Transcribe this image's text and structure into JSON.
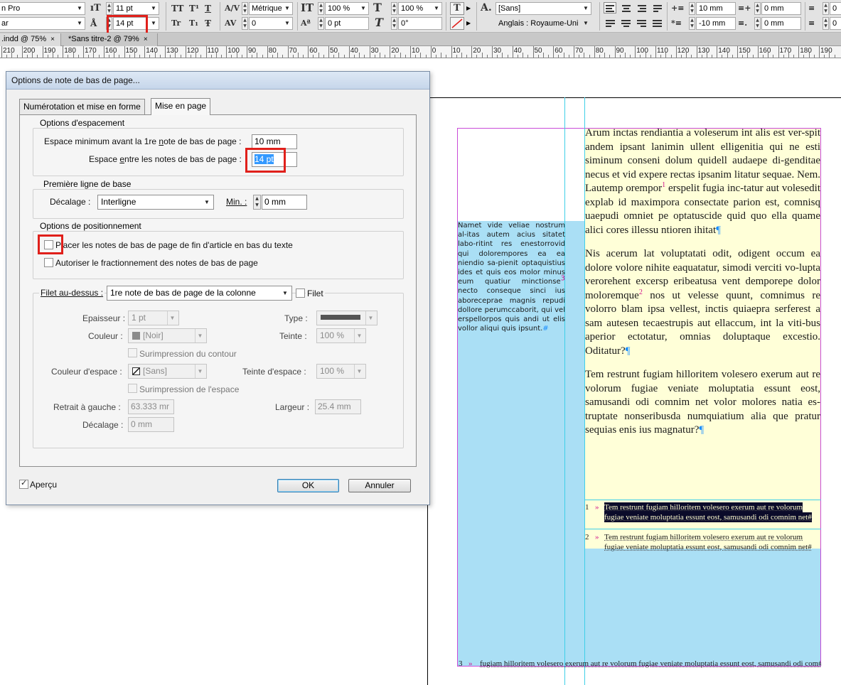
{
  "control_bar": {
    "font_family": "n Pro",
    "font_style": "ar",
    "font_size": "11 pt",
    "leading": "14 pt",
    "kerning": "Métrique",
    "tracking": "0",
    "vertical_scale": "100 %",
    "baseline_shift": "0 pt",
    "horizontal_scale": "100 %",
    "skew": "0°",
    "char_style": "[Sans]",
    "language": "Anglais : Royaume-Uni",
    "left_indent": "10 mm",
    "first_line_indent": "-10 mm",
    "right_indent": "0 mm",
    "space_after": "0 mm",
    "overflow_field": "0",
    "overflow_field_2": "0",
    "caps_glyphs": [
      "TT",
      "T¹",
      "T",
      "Tr",
      "T₁",
      "Ŧ"
    ]
  },
  "doc_tabs": [
    {
      "label": ".indd @ 75%",
      "close": "×"
    },
    {
      "label": "*Sans titre-2 @ 79%",
      "close": "×"
    }
  ],
  "ruler": {
    "labels": [
      "210",
      "200",
      "190",
      "180",
      "170",
      "160",
      "150",
      "140",
      "130",
      "120",
      "110",
      "100",
      "90",
      "80",
      "70",
      "60",
      "50",
      "40",
      "30",
      "20",
      "10",
      "0",
      "10",
      "20",
      "30",
      "40",
      "50",
      "60",
      "70",
      "80",
      "90",
      "100",
      "110",
      "120",
      "130",
      "140",
      "150",
      "160",
      "170",
      "180",
      "190"
    ]
  },
  "dialog": {
    "title": "Options de note de bas de page...",
    "tabs": [
      "Numérotation et mise en forme",
      "Mise en page"
    ],
    "spacing": {
      "group_title": "Options d'espacement",
      "min_space_label_pre": "Espace minimum avant la 1re ",
      "min_space_label_ul": "n",
      "min_space_label_post": "ote de bas de page :",
      "min_space_value": "10 mm",
      "between_label_pre": "Espace ",
      "between_label_ul": "e",
      "between_label_post": "ntre les notes de bas de page :",
      "between_value": "14 pt"
    },
    "baseline": {
      "group_title": "Première ligne de base",
      "offset_label": "Décalage :",
      "offset_value": "Interligne",
      "min_label": "Min. :",
      "min_value": "0 mm"
    },
    "positioning": {
      "group_title": "Options de positionnement",
      "place_end_label": "Placer les notes de bas de page de fin d'article en bas du texte",
      "allow_split_label": "Autoriser le fractionnement des notes de bas de page"
    },
    "rule": {
      "rule_above_label": "Filet au-dessus :",
      "rule_above_value": "1re note de bas de page de la colonne",
      "rule_on_label": "Filet",
      "weight_label": "Epaisseur :",
      "weight_value": "1 pt",
      "type_label": "Type :",
      "color_label": "Couleur :",
      "color_value": "[Noir]",
      "tint_label": "Teinte :",
      "tint_value": "100 %",
      "overprint_stroke_label": "Surimpression du contour",
      "gap_color_label": "Couleur d'espace :",
      "gap_color_value": "[Sans]",
      "gap_tint_label": "Teinte d'espace :",
      "gap_tint_value": "100 %",
      "overprint_gap_label": "Surimpression de l'espace",
      "left_indent_label": "Retrait à gauche :",
      "left_indent_value": "63.333 mr",
      "width_label": "Largeur :",
      "width_value": "25.4 mm",
      "offset_label": "Décalage :",
      "offset_value": "0 mm"
    },
    "preview_label": "Aperçu",
    "ok_label": "OK",
    "cancel_label": "Annuler"
  },
  "document": {
    "side_text": "Namet vide veliae nostrum al-itas autem acius sitatet labo-ritint res enestorrovid qui dolorempores ea ea niendio sa-pienit optaquistius ides et quis eos molor minus eum quatiur minctionse",
    "side_text_mark": "3",
    "side_text_tail": " necto conseque sinci ius aboreceprae magnis repudi dollore perumccaborit, qui vel erspellorpos quis andi ut elis vollor aliqui quis ipsunt.",
    "side_text_end": "#",
    "para1_a": "Arum inctas rendiantia a voleserum int alis est ver-spit andem ipsant lanimin ullent elligenitia qui ne esti siminum conseni dolum quidell audaepe di-genditae necus et vid expere rectas ipsanim litatur sequae. Nem. Lautemp orempor",
    "para1_mark": "1",
    "para1_b": " erspelit fugia inc-tatur aut volesedit explab id maximpora consectate parion est, comnisq uaepudi omniet pe optatuscide quid quo ella quame alici cores illessu ntioren ihitat",
    "para1_end": "¶",
    "para2_a": "Nis acerum lat voluptatati odit, odigent occum ea dolore volore nihite eaquatatur, simodi verciti vo-lupta verorehent excersp eribeatusa vent demporepe dolor moloremque",
    "para2_mark": "2",
    "para2_b": " nos ut velesse quunt, comnimus re volorro blam ipsa vellest, inctis quiaepra serferest a sam autesen tecaestrupis aut ellaccum, int la viti-bus aperior ectotatur, omnias doluptaque excestio. Oditatur?",
    "para2_end": "¶",
    "para3": "Tem restrunt fugiam hilloritem volesero exerum aut re volorum fugiae veniate moluptatia essunt eost, samusandi odi comnim net volor molores natia es-truptate nonseribusda numquiatium alia que pratur sequias enis ius magnatur?",
    "para3_end": "¶",
    "footnotes": [
      {
        "num": "1",
        "arrow": "»",
        "line1": "Tem restrunt fugiam hilloritem volesero exerum aut re volorum",
        "line2": "fugiae veniate moluptatia essunt eost, samusandi odi comnim net#"
      },
      {
        "num": "2",
        "arrow": "»",
        "line1": "Tem restrunt fugiam hilloritem volesero exerum aut re volorum",
        "line2": "fugiae veniate moluptatia essunt eost, samusandi odi comnim net#"
      }
    ],
    "bottom_note": {
      "num": "3",
      "arrow": "»",
      "text": "fugiam hilloritem volesero exerum aut re volorum fugiae veniate moluptatia essunt eost, samusandi odi com#"
    }
  },
  "colors": {
    "highlight_red": "#e0201b",
    "frame_blue": "#aadff5",
    "frame_yellow": "#ffffd8",
    "margin_magenta": "#c94bd8",
    "guide_cyan": "#3fd0e8",
    "footnote_mark": "#d0108a"
  }
}
